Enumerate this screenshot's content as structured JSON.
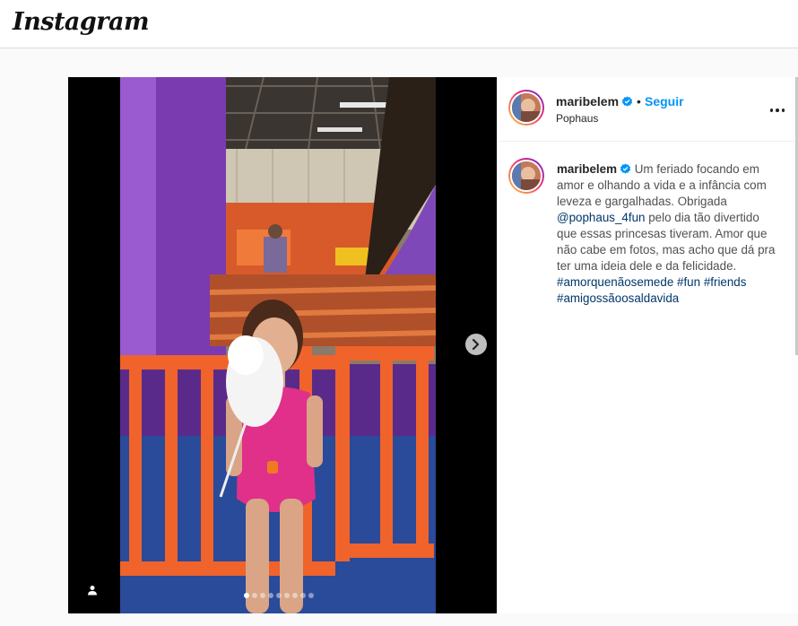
{
  "app": {
    "logo_text": "Instagram"
  },
  "post": {
    "username": "maribelem",
    "follow_label": "Seguir",
    "separator": "•",
    "location": "Pophaus",
    "carousel": {
      "total_slides": 9,
      "active_index": 0
    },
    "caption": {
      "username": "maribelem",
      "text_1": " Um feriado focando em amor e olhando a vida e a infância com leveza e gargalhadas. Obrigada ",
      "mention": "@pophaus_4fun",
      "text_2": " pelo dia tão divertido que essas princesas tiveram. Amor que não cabe em fotos, mas acho que dá pra ter uma ideia dele e da felicidade.",
      "hashtags": [
        "#amorquenãosemede",
        "#fun",
        "#friends",
        "#amigossãoosaldavida"
      ]
    }
  },
  "colors": {
    "accent": "#0095f6",
    "link": "#00376b",
    "verified": "#0095f6"
  }
}
